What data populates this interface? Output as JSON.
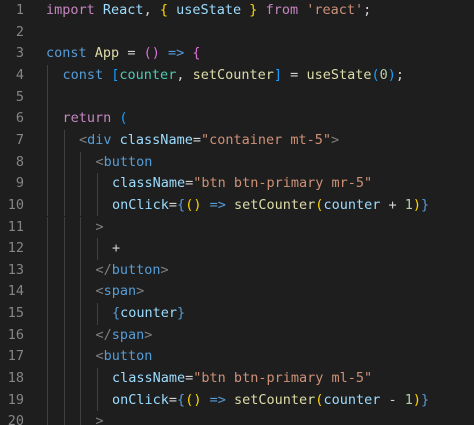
{
  "editor": {
    "language": "javascript-react",
    "colors": {
      "background": "#1e1e1e",
      "line_number": "#858585",
      "keyword_control": "#c586c0",
      "keyword_storage": "#569cd6",
      "tag": "#569cd6",
      "tag_punctuation": "#808080",
      "function": "#dcdcaa",
      "variable": "#9cdcfe",
      "component": "#4ec9b0",
      "string": "#ce9178",
      "number": "#b5cea8",
      "text": "#d4d4d4",
      "bracket_level_1": "#ffd700",
      "bracket_level_2": "#da70d6",
      "bracket_level_3": "#179fff"
    },
    "lines": [
      {
        "number": "1",
        "indent": 0,
        "tokens": [
          {
            "t": "import",
            "c": "kw"
          },
          {
            "t": " ",
            "c": "tx"
          },
          {
            "t": "React",
            "c": "vr"
          },
          {
            "t": ", ",
            "c": "tx"
          },
          {
            "t": "{",
            "c": "br"
          },
          {
            "t": " ",
            "c": "tx"
          },
          {
            "t": "useState",
            "c": "vr"
          },
          {
            "t": " ",
            "c": "tx"
          },
          {
            "t": "}",
            "c": "br"
          },
          {
            "t": " ",
            "c": "tx"
          },
          {
            "t": "from",
            "c": "kw"
          },
          {
            "t": " ",
            "c": "tx"
          },
          {
            "t": "'react'",
            "c": "sr"
          },
          {
            "t": ";",
            "c": "tx"
          }
        ]
      },
      {
        "number": "2",
        "indent": 0,
        "tokens": []
      },
      {
        "number": "3",
        "indent": 0,
        "tokens": [
          {
            "t": "const",
            "c": "st"
          },
          {
            "t": " ",
            "c": "tx"
          },
          {
            "t": "App",
            "c": "fn"
          },
          {
            "t": " ",
            "c": "tx"
          },
          {
            "t": "=",
            "c": "tx"
          },
          {
            "t": " ",
            "c": "tx"
          },
          {
            "t": "(",
            "c": "br2"
          },
          {
            "t": ")",
            "c": "br2"
          },
          {
            "t": " ",
            "c": "tx"
          },
          {
            "t": "=>",
            "c": "st"
          },
          {
            "t": " ",
            "c": "tx"
          },
          {
            "t": "{",
            "c": "br2"
          }
        ]
      },
      {
        "number": "4",
        "indent": 1,
        "tokens": [
          {
            "t": "const",
            "c": "st"
          },
          {
            "t": " ",
            "c": "tx"
          },
          {
            "t": "[",
            "c": "br3"
          },
          {
            "t": "counter",
            "c": "co"
          },
          {
            "t": ", ",
            "c": "tx"
          },
          {
            "t": "setCounter",
            "c": "fn"
          },
          {
            "t": "]",
            "c": "br3"
          },
          {
            "t": " ",
            "c": "tx"
          },
          {
            "t": "=",
            "c": "tx"
          },
          {
            "t": " ",
            "c": "tx"
          },
          {
            "t": "useState",
            "c": "fn"
          },
          {
            "t": "(",
            "c": "br3"
          },
          {
            "t": "0",
            "c": "nm"
          },
          {
            "t": ")",
            "c": "br3"
          },
          {
            "t": ";",
            "c": "tx"
          }
        ]
      },
      {
        "number": "5",
        "indent": 1,
        "tokens": []
      },
      {
        "number": "6",
        "indent": 1,
        "tokens": [
          {
            "t": "return",
            "c": "kw"
          },
          {
            "t": " ",
            "c": "tx"
          },
          {
            "t": "(",
            "c": "br3"
          }
        ]
      },
      {
        "number": "7",
        "indent": 2,
        "tokens": [
          {
            "t": "<",
            "c": "pn"
          },
          {
            "t": "div",
            "c": "tg"
          },
          {
            "t": " ",
            "c": "tx"
          },
          {
            "t": "className",
            "c": "at"
          },
          {
            "t": "=",
            "c": "tx"
          },
          {
            "t": "\"container mt-5\"",
            "c": "sr"
          },
          {
            "t": ">",
            "c": "pn"
          }
        ]
      },
      {
        "number": "8",
        "indent": 3,
        "tokens": [
          {
            "t": "<",
            "c": "pn"
          },
          {
            "t": "button",
            "c": "tg"
          }
        ]
      },
      {
        "number": "9",
        "indent": 4,
        "tokens": [
          {
            "t": "className",
            "c": "at"
          },
          {
            "t": "=",
            "c": "tx"
          },
          {
            "t": "\"btn btn-primary mr-5\"",
            "c": "sr"
          }
        ]
      },
      {
        "number": "10",
        "indent": 4,
        "tokens": [
          {
            "t": "onClick",
            "c": "at"
          },
          {
            "t": "=",
            "c": "tx"
          },
          {
            "t": "{",
            "c": "st"
          },
          {
            "t": "(",
            "c": "br"
          },
          {
            "t": ")",
            "c": "br"
          },
          {
            "t": " ",
            "c": "tx"
          },
          {
            "t": "=>",
            "c": "st"
          },
          {
            "t": " ",
            "c": "tx"
          },
          {
            "t": "setCounter",
            "c": "fn"
          },
          {
            "t": "(",
            "c": "br"
          },
          {
            "t": "counter",
            "c": "vr"
          },
          {
            "t": " ",
            "c": "tx"
          },
          {
            "t": "+",
            "c": "tx"
          },
          {
            "t": " ",
            "c": "tx"
          },
          {
            "t": "1",
            "c": "nm"
          },
          {
            "t": ")",
            "c": "br"
          },
          {
            "t": "}",
            "c": "st"
          }
        ]
      },
      {
        "number": "11",
        "indent": 3,
        "tokens": [
          {
            "t": ">",
            "c": "pn"
          }
        ]
      },
      {
        "number": "12",
        "indent": 4,
        "tokens": [
          {
            "t": "+",
            "c": "tx"
          }
        ]
      },
      {
        "number": "13",
        "indent": 3,
        "tokens": [
          {
            "t": "</",
            "c": "pn"
          },
          {
            "t": "button",
            "c": "tg"
          },
          {
            "t": ">",
            "c": "pn"
          }
        ]
      },
      {
        "number": "14",
        "indent": 3,
        "tokens": [
          {
            "t": "<",
            "c": "pn"
          },
          {
            "t": "span",
            "c": "tg"
          },
          {
            "t": ">",
            "c": "pn"
          }
        ]
      },
      {
        "number": "15",
        "indent": 4,
        "tokens": [
          {
            "t": "{",
            "c": "st"
          },
          {
            "t": "counter",
            "c": "vr"
          },
          {
            "t": "}",
            "c": "st"
          }
        ]
      },
      {
        "number": "16",
        "indent": 3,
        "tokens": [
          {
            "t": "</",
            "c": "pn"
          },
          {
            "t": "span",
            "c": "tg"
          },
          {
            "t": ">",
            "c": "pn"
          }
        ]
      },
      {
        "number": "17",
        "indent": 3,
        "tokens": [
          {
            "t": "<",
            "c": "pn"
          },
          {
            "t": "button",
            "c": "tg"
          }
        ]
      },
      {
        "number": "18",
        "indent": 4,
        "tokens": [
          {
            "t": "className",
            "c": "at"
          },
          {
            "t": "=",
            "c": "tx"
          },
          {
            "t": "\"btn btn-primary ml-5\"",
            "c": "sr"
          }
        ]
      },
      {
        "number": "19",
        "indent": 4,
        "tokens": [
          {
            "t": "onClick",
            "c": "at"
          },
          {
            "t": "=",
            "c": "tx"
          },
          {
            "t": "{",
            "c": "st"
          },
          {
            "t": "(",
            "c": "br"
          },
          {
            "t": ")",
            "c": "br"
          },
          {
            "t": " ",
            "c": "tx"
          },
          {
            "t": "=>",
            "c": "st"
          },
          {
            "t": " ",
            "c": "tx"
          },
          {
            "t": "setCounter",
            "c": "fn"
          },
          {
            "t": "(",
            "c": "br"
          },
          {
            "t": "counter",
            "c": "vr"
          },
          {
            "t": " ",
            "c": "tx"
          },
          {
            "t": "-",
            "c": "tx"
          },
          {
            "t": " ",
            "c": "tx"
          },
          {
            "t": "1",
            "c": "nm"
          },
          {
            "t": ")",
            "c": "br"
          },
          {
            "t": "}",
            "c": "st"
          }
        ]
      },
      {
        "number": "20",
        "indent": 3,
        "tokens": [
          {
            "t": ">",
            "c": "pn"
          }
        ]
      }
    ]
  }
}
